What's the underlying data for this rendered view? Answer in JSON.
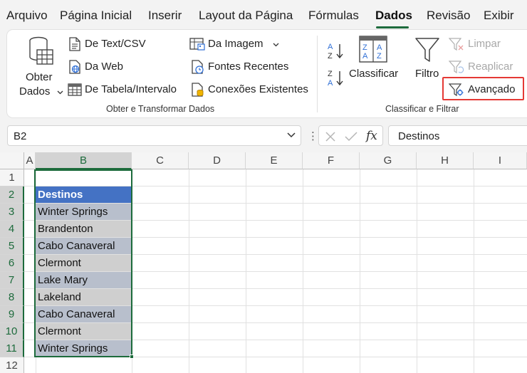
{
  "menu": {
    "tabs": [
      {
        "label": "Arquivo",
        "active": false
      },
      {
        "label": "Página Inicial",
        "active": false
      },
      {
        "label": "Inserir",
        "active": false
      },
      {
        "label": "Layout da Página",
        "active": false
      },
      {
        "label": "Fórmulas",
        "active": false
      },
      {
        "label": "Dados",
        "active": true
      },
      {
        "label": "Revisão",
        "active": false
      },
      {
        "label": "Exibir",
        "active": false
      }
    ]
  },
  "ribbon": {
    "get_data": {
      "obter_dados_line1": "Obter",
      "obter_dados_line2": "Dados",
      "from_text_csv": "De Text/CSV",
      "from_web": "Da Web",
      "from_table": "De Tabela/Intervalo",
      "from_picture": "Da Imagem",
      "recent_sources": "Fontes Recentes",
      "existing_connections": "Conexões Existentes",
      "group_label": "Obter e Transformar Dados"
    },
    "sort_filter": {
      "sort_az": "A→Z",
      "sort_za": "Z→A",
      "sort": "Classificar",
      "filter": "Filtro",
      "clear": "Limpar",
      "reapply": "Reaplicar",
      "advanced": "Avançado",
      "group_label": "Classificar e Filtrar"
    }
  },
  "formula_bar": {
    "name_box": "B2",
    "fx": "fx",
    "value": "Destinos"
  },
  "sheet": {
    "columns": [
      "A",
      "B",
      "C",
      "D",
      "E",
      "F",
      "G",
      "H",
      "I"
    ],
    "rows": [
      "1",
      "2",
      "3",
      "4",
      "5",
      "6",
      "7",
      "8",
      "9",
      "10",
      "11",
      "12"
    ],
    "selected_column": "B",
    "cells_B": [
      "Destinos",
      "Winter Springs",
      "Brandenton",
      "Cabo Canaveral",
      "Clermont",
      "Lake Mary",
      "Lakeland",
      "Cabo Canaveral",
      "Clermont",
      "Winter Springs"
    ]
  },
  "colors": {
    "accent_green": "#1d6b3c",
    "table_header": "#4472c4",
    "highlight_red": "#e53935"
  }
}
